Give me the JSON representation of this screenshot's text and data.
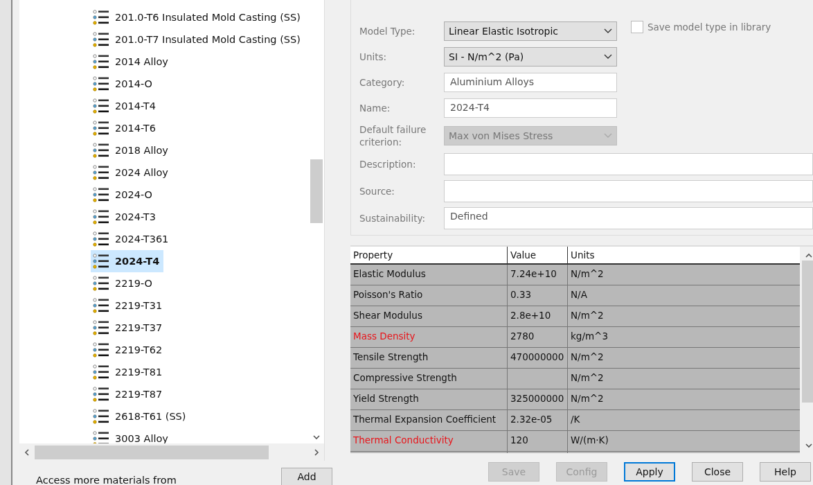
{
  "materials": [
    {
      "label": "201.0-T6 Insulated Mold Casting (SS)",
      "selected": false
    },
    {
      "label": "201.0-T7 Insulated Mold Casting (SS)",
      "selected": false
    },
    {
      "label": "2014 Alloy",
      "selected": false
    },
    {
      "label": "2014-O",
      "selected": false
    },
    {
      "label": "2014-T4",
      "selected": false
    },
    {
      "label": "2014-T6",
      "selected": false
    },
    {
      "label": "2018 Alloy",
      "selected": false
    },
    {
      "label": "2024 Alloy",
      "selected": false
    },
    {
      "label": "2024-O",
      "selected": false
    },
    {
      "label": "2024-T3",
      "selected": false
    },
    {
      "label": "2024-T361",
      "selected": false
    },
    {
      "label": "2024-T4",
      "selected": true
    },
    {
      "label": "2219-O",
      "selected": false
    },
    {
      "label": "2219-T31",
      "selected": false
    },
    {
      "label": "2219-T37",
      "selected": false
    },
    {
      "label": "2219-T62",
      "selected": false
    },
    {
      "label": "2219-T81",
      "selected": false
    },
    {
      "label": "2219-T87",
      "selected": false
    },
    {
      "label": "2618-T61 (SS)",
      "selected": false
    },
    {
      "label": "3003 Alloy",
      "selected": false
    }
  ],
  "access_text": "Access more materials from",
  "add_button": "Add",
  "form": {
    "model_type": {
      "label": "Model Type:",
      "value": "Linear Elastic Isotropic",
      "disabled": false
    },
    "save_model_type": {
      "label": "Save model type in library",
      "checked": false
    },
    "units": {
      "label": "Units:",
      "value": "SI - N/m^2 (Pa)",
      "disabled": false
    },
    "category": {
      "label": "Category:",
      "value": "Aluminium Alloys"
    },
    "name": {
      "label": "Name:",
      "value": "2024-T4"
    },
    "failure_criterion": {
      "label": "Default failure criterion:",
      "value": "Max von Mises Stress",
      "disabled": true
    },
    "description": {
      "label": "Description:"
    },
    "source": {
      "label": "Source:"
    },
    "sustainability": {
      "label": "Sustainability:",
      "value": "Defined"
    }
  },
  "table": {
    "columns": [
      "Property",
      "Value",
      "Units"
    ],
    "rows": [
      {
        "property": "Elastic Modulus",
        "value": "7.24e+10",
        "units": "N/m^2",
        "required": false
      },
      {
        "property": "Poisson's Ratio",
        "value": "0.33",
        "units": "N/A",
        "required": false
      },
      {
        "property": "Shear Modulus",
        "value": "2.8e+10",
        "units": "N/m^2",
        "required": false
      },
      {
        "property": "Mass Density",
        "value": "2780",
        "units": "kg/m^3",
        "required": true
      },
      {
        "property": "Tensile Strength",
        "value": "470000000",
        "units": "N/m^2",
        "required": false
      },
      {
        "property": "Compressive Strength",
        "value": "",
        "units": "N/m^2",
        "required": false
      },
      {
        "property": "Yield Strength",
        "value": "325000000",
        "units": "N/m^2",
        "required": false
      },
      {
        "property": "Thermal Expansion Coefficient",
        "value": "2.32e-05",
        "units": "/K",
        "required": false
      },
      {
        "property": "Thermal Conductivity",
        "value": "120",
        "units": "W/(m·K)",
        "required": true
      }
    ]
  },
  "buttons": [
    {
      "label": "Save",
      "disabled": true,
      "default": false
    },
    {
      "label": "Config",
      "disabled": true,
      "default": false
    },
    {
      "label": "Apply",
      "disabled": false,
      "default": true
    },
    {
      "label": "Close",
      "disabled": false,
      "default": false
    },
    {
      "label": "Help",
      "disabled": false,
      "default": false
    }
  ]
}
